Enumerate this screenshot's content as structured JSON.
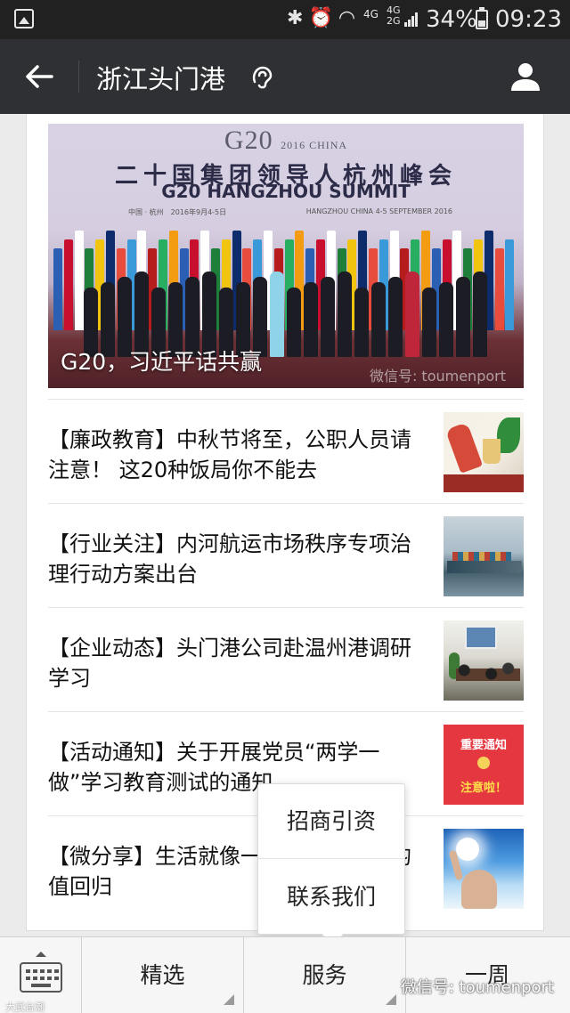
{
  "status_bar": {
    "network_top": "4G",
    "network_stack": [
      "4G",
      "2G"
    ],
    "battery": "34%",
    "time": "09:23",
    "icons": [
      "gallery-icon",
      "bluetooth-icon",
      "alarm-icon",
      "wifi-icon",
      "signal-icon",
      "battery-icon"
    ]
  },
  "header": {
    "title": "浙江头门港",
    "icons": [
      "back-arrow-icon",
      "listen-icon",
      "user-profile-icon"
    ]
  },
  "hero": {
    "logo": "G20",
    "logo_year": "2016",
    "logo_country": "CHINA",
    "title_cn": "二十国集团领导人杭州峰会",
    "title_en": "G20 HANGZHOU SUMMIT",
    "meta_left": "中国 · 杭州　2016年9月4-5日",
    "meta_right": "HANGZHOU CHINA  4-5 SEPTEMBER 2016",
    "caption": "G20，习近平话共赢",
    "watermark": "微信号: toumenport"
  },
  "articles": [
    {
      "title": "【廉政教育】中秋节将至，公职人员请注意！ 这20种饭局你不能去"
    },
    {
      "title": "【行业关注】内河航运市场秩序专项治理行动方案出台"
    },
    {
      "title": "【企业动态】头门港公司赴温州港调研学习"
    },
    {
      "title": "【活动通知】关于开展党员“两学一做”学习教育测试的通知",
      "thumb_line1": "重要通知",
      "thumb_line2": "注意啦！"
    },
    {
      "title": "【微分享】生活就像一场旅行，终将均值回归"
    }
  ],
  "popup_menu": {
    "items": [
      "招商引资",
      "联系我们"
    ]
  },
  "bottom_menu": {
    "items": [
      "精选",
      "服务",
      "一周"
    ],
    "watermark": "微信号: toumenport",
    "watermark_small": "大武台潮"
  },
  "colors": {
    "status_bar_bg": "#212121",
    "header_bg": "#2f3033",
    "page_bg": "#ebebeb",
    "popup_bg": "#ffffff",
    "notice_red": "#e53740"
  }
}
